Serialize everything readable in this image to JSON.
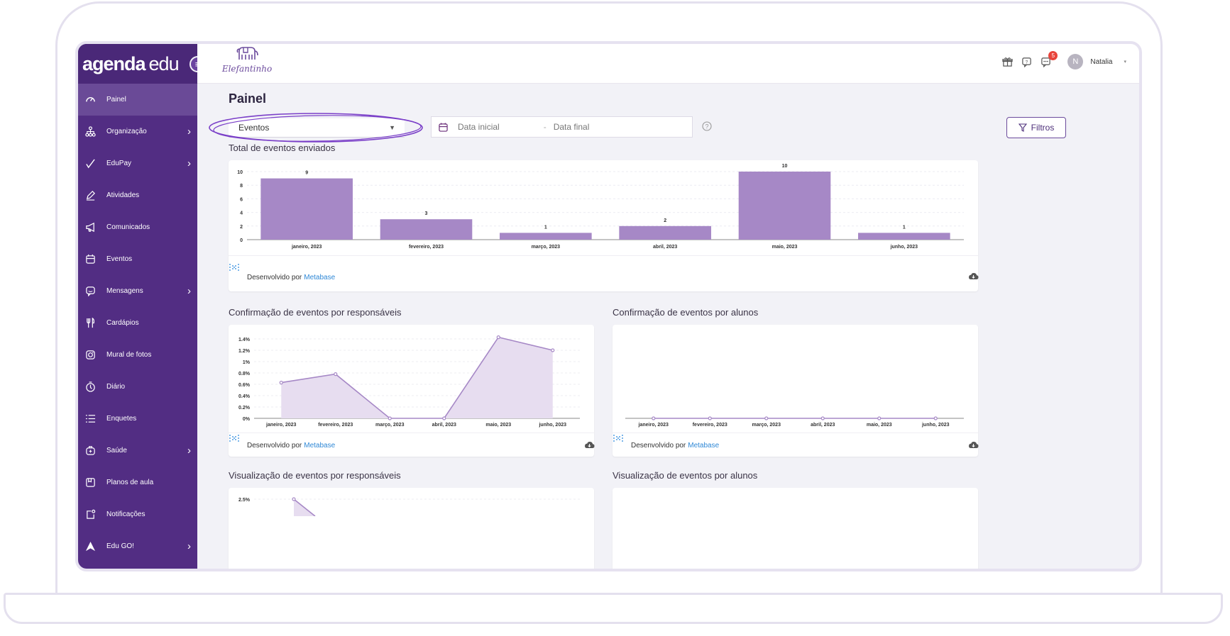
{
  "brand": {
    "name_bold": "agenda",
    "name_light": "edu"
  },
  "school": {
    "name": "Elefantinho"
  },
  "sidebar": {
    "items": [
      {
        "label": "Painel",
        "icon": "gauge-icon",
        "active": true,
        "chevron": false
      },
      {
        "label": "Organização",
        "icon": "org-chart-icon",
        "active": false,
        "chevron": true
      },
      {
        "label": "EduPay",
        "icon": "checkmark-pen-icon",
        "active": false,
        "chevron": true
      },
      {
        "label": "Atividades",
        "icon": "pencil-icon",
        "active": false,
        "chevron": false
      },
      {
        "label": "Comunicados",
        "icon": "megaphone-icon",
        "active": false,
        "chevron": false
      },
      {
        "label": "Eventos",
        "icon": "calendar-icon",
        "active": false,
        "chevron": false
      },
      {
        "label": "Mensagens",
        "icon": "chat-icon",
        "active": false,
        "chevron": true
      },
      {
        "label": "Cardápios",
        "icon": "cutlery-icon",
        "active": false,
        "chevron": false
      },
      {
        "label": "Mural de fotos",
        "icon": "camera-icon",
        "active": false,
        "chevron": false
      },
      {
        "label": "Diário",
        "icon": "stopwatch-icon",
        "active": false,
        "chevron": false
      },
      {
        "label": "Enquetes",
        "icon": "list-icon",
        "active": false,
        "chevron": false
      },
      {
        "label": "Saúde",
        "icon": "first-aid-icon",
        "active": false,
        "chevron": true
      },
      {
        "label": "Planos de aula",
        "icon": "clipboard-icon",
        "active": false,
        "chevron": false
      },
      {
        "label": "Notificações",
        "icon": "notification-icon",
        "active": false,
        "chevron": false
      },
      {
        "label": "Edu GO!",
        "icon": "edu-go-icon",
        "active": false,
        "chevron": true
      }
    ]
  },
  "topbar": {
    "chat_badge": "5",
    "avatar_initial": "N",
    "user_name": "Natalia"
  },
  "page": {
    "title": "Painel"
  },
  "filters": {
    "select_value": "Eventos",
    "date_start_placeholder": "Data inicial",
    "date_separator": "-",
    "date_end_placeholder": "Data final",
    "filters_button": "Filtros"
  },
  "footer": {
    "developed_by": "Desenvolvido por",
    "link": "Metabase"
  },
  "colors": {
    "sidebar": "#522d83",
    "bar": "#a688c6",
    "line": "#a688c6",
    "area": "#e7ddf0",
    "accent": "#6b4a9b"
  },
  "sections": {
    "total": "Total de eventos enviados",
    "confirm_resp": "Confirmação de eventos por responsáveis",
    "confirm_alunos": "Confirmação de eventos por alunos",
    "view_resp": "Visualização de eventos por responsáveis",
    "view_alunos": "Visualização de eventos por alunos"
  },
  "chart_data": [
    {
      "type": "bar",
      "title": "Total de eventos enviados",
      "categories": [
        "janeiro, 2023",
        "fevereiro, 2023",
        "março, 2023",
        "abril, 2023",
        "maio, 2023",
        "junho, 2023"
      ],
      "values": [
        9,
        3,
        1,
        2,
        10,
        1
      ],
      "yticks": [
        "0",
        "2",
        "4",
        "6",
        "8",
        "10"
      ],
      "ylim": [
        0,
        10
      ]
    },
    {
      "type": "area",
      "title": "Confirmação de eventos por responsáveis",
      "categories": [
        "janeiro, 2023",
        "fevereiro, 2023",
        "março, 2023",
        "abril, 2023",
        "maio, 2023",
        "junho, 2023"
      ],
      "values": [
        0.63,
        0.78,
        0,
        0,
        1.43,
        1.2
      ],
      "yticks": [
        "0%",
        "0.2%",
        "0.4%",
        "0.6%",
        "0.8%",
        "1%",
        "1.2%",
        "1.4%"
      ],
      "ylim": [
        0,
        1.5
      ]
    },
    {
      "type": "line",
      "title": "Confirmação de eventos por alunos",
      "categories": [
        "janeiro, 2023",
        "fevereiro, 2023",
        "março, 2023",
        "abril, 2023",
        "maio, 2023",
        "junho, 2023"
      ],
      "values": [
        0,
        0,
        0,
        0,
        0,
        0
      ]
    },
    {
      "type": "area",
      "title": "Visualização de eventos por responsáveis",
      "yticks": [
        "2.5%"
      ],
      "values": [
        2.5
      ]
    }
  ]
}
